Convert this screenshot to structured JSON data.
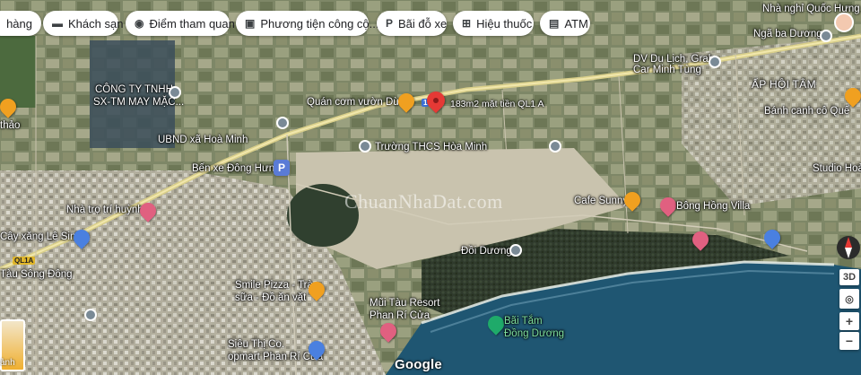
{
  "chips": [
    {
      "label": "hàng",
      "icon": "restaurant-icon"
    },
    {
      "label": "Khách sạn",
      "icon": "bed-icon"
    },
    {
      "label": "Điểm tham quan",
      "icon": "camera-icon"
    },
    {
      "label": "Phương tiện công cộ...",
      "icon": "bus-icon"
    },
    {
      "label": "Bãi đỗ xe",
      "icon": "parking-icon"
    },
    {
      "label": "Hiệu thuốc",
      "icon": "pharmacy-icon"
    },
    {
      "label": "ATM",
      "icon": "atm-icon"
    }
  ],
  "places": {
    "nha_nghi": "Nhà nghỉ Quốc Hưng",
    "nga_ba": "Ngã ba Dương",
    "dv_du_lich_1": "DV Du Lịch, Grab",
    "dv_du_lich_2": "Car Minh Tùng",
    "ap_hoi_tam": "ẤP HỘI TÂM",
    "banh_canh": "Bánh canh cô Quế",
    "studio": "Studio Hoà",
    "cong_ty_1": "CÔNG TY TNHH",
    "cong_ty_2": "SX-TM MAY MẶC...",
    "quan_com": "Quán cơm vườn Dừa",
    "road_note": "183m2 mặt tiền QL1 A",
    "ubnd": "UBND xã Hoà Minh",
    "truong": "Trường THCS Hòa Minh",
    "ben_xe": "Bến xe Đông Hưng",
    "cafe": "Cafe Sunny",
    "bong_hong": "Bông Hồng Villa",
    "nha_tro": "Nhà trọ trí huỳnh",
    "cay_xang": "Cây xăng Lê Sinh",
    "qua": "QL1A",
    "song_dong": "Tàu Sông Đông",
    "thao": "thảo",
    "doi_duong": "Đồi Dương",
    "smile_1": "Smile Pizza - Trà",
    "smile_2": "sữa - Đồ ăn vặt",
    "mui_tau_1": "Mũi Tàu Resort",
    "mui_tau_2": "Phan Rí Cửa",
    "bai_tam_1": "Bãi Tắm",
    "bai_tam_2": "Đồng Dương",
    "sieu_thi_1": "Siêu Thị Co.",
    "sieu_thi_2": "opmart Phan Rí Cửa",
    "thumb_caption": "ảnh"
  },
  "watermark": "ChuanNhaDat.com",
  "google_logo": "Google",
  "controls": {
    "view_3d": "3D",
    "zoom_in": "+",
    "zoom_out": "−"
  }
}
